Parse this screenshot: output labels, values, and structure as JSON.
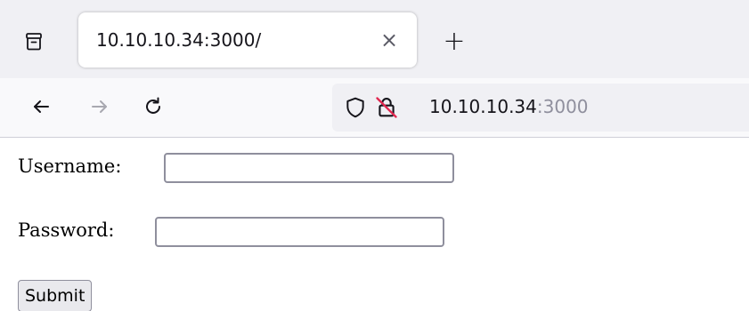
{
  "browser": {
    "tab": {
      "title": "10.10.10.34:3000/",
      "close_symbol": "×"
    },
    "new_tab_symbol": "+",
    "icons": {
      "tab_list": "tab-list-icon",
      "back": "back-arrow-icon",
      "forward": "forward-arrow-icon",
      "reload": "reload-icon",
      "tracking_protection": "shield-icon",
      "insecure_connection": "lock-strikethrough-icon"
    },
    "url": {
      "host": "10.10.10.34",
      "port": ":3000"
    }
  },
  "form": {
    "username_label": "Username:",
    "username_value": "",
    "password_label": "Password:",
    "password_value": "",
    "submit_label": "Submit"
  }
}
